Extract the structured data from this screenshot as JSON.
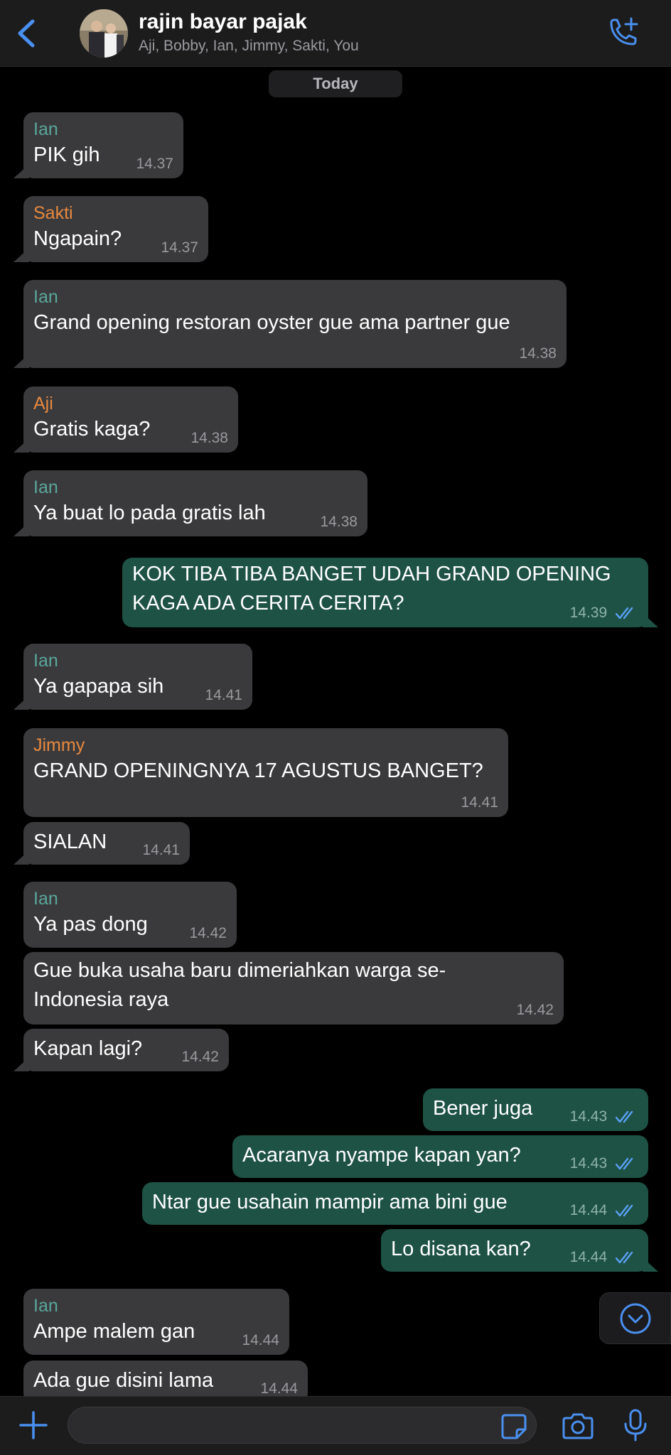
{
  "header": {
    "title": "rajin bayar pajak",
    "members": "Aji, Bobby, Ian, Jimmy, Sakti, You"
  },
  "date_label": "Today",
  "colors": {
    "accent": "#4a90f0",
    "incoming_bubble": "#3a3a3c",
    "outgoing_bubble": "#1e5245",
    "sender_ian": "#5aa79b",
    "sender_orange": "#e8893e",
    "read_ticks": "#5aa0f5"
  },
  "messages": [
    {
      "sender": "Ian",
      "text": "PIK gih",
      "time": "14.37"
    },
    {
      "sender": "Sakti",
      "text": "Ngapain?",
      "time": "14.37"
    },
    {
      "sender": "Ian",
      "text": "Grand opening restoran oyster gue ama partner gue",
      "time": "14.38"
    },
    {
      "sender": "Aji",
      "text": "Gratis kaga?",
      "time": "14.38"
    },
    {
      "sender": "Ian",
      "text": "Ya buat lo pada gratis lah",
      "time": "14.38"
    },
    {
      "sender": "",
      "text": "KOK TIBA TIBA BANGET UDAH GRAND OPENING",
      "text2": "KAGA ADA CERITA CERITA?",
      "time": "14.39"
    },
    {
      "sender": "Ian",
      "text": "Ya gapapa sih",
      "time": "14.41"
    },
    {
      "sender": "Jimmy",
      "text": "GRAND OPENINGNYA 17 AGUSTUS BANGET?",
      "time": "14.41"
    },
    {
      "sender": "",
      "text": "SIALAN",
      "time": "14.41"
    },
    {
      "sender": "Ian",
      "text": "Ya pas dong",
      "time": "14.42"
    },
    {
      "sender": "",
      "text": "Gue buka usaha baru dimeriahkan warga se-",
      "text2": "Indonesia raya",
      "time": "14.42"
    },
    {
      "sender": "",
      "text": "Kapan lagi?",
      "time": "14.42"
    },
    {
      "sender": "",
      "text": "Bener juga",
      "time": "14.43"
    },
    {
      "sender": "",
      "text": "Acaranya nyampe kapan yan?",
      "time": "14.43"
    },
    {
      "sender": "",
      "text": "Ntar gue usahain mampir ama bini gue",
      "time": "14.44"
    },
    {
      "sender": "",
      "text": "Lo disana kan?",
      "time": "14.44"
    },
    {
      "sender": "Ian",
      "text": "Ampe malem gan",
      "time": "14.44"
    },
    {
      "sender": "",
      "text": "Ada gue disini lama",
      "time": "14.44"
    }
  ],
  "input": {
    "placeholder": ""
  }
}
